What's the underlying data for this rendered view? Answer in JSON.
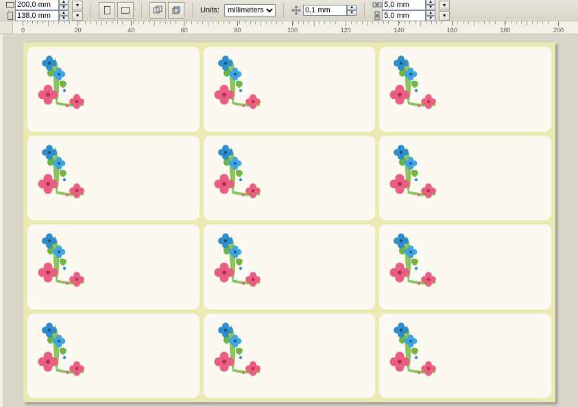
{
  "toolbar": {
    "width": "200,0 mm",
    "height": "138,0 mm",
    "units_label": "Units:",
    "units_value": "millimeters",
    "nudge": "0,1 mm",
    "dup_x": "5,0 mm",
    "dup_y": "5,0 mm"
  },
  "ruler": {
    "ticks": [
      0,
      20,
      40,
      60,
      80,
      100,
      120,
      140,
      160,
      180,
      200
    ]
  },
  "icons": {
    "landscape": "landscape-icon",
    "portrait": "portrait-icon",
    "overlap": "overlap-icon",
    "behind": "behind-icon",
    "nudge": "nudge-arrows-icon",
    "dupx": "duplicate-x-icon",
    "dupy": "duplicate-y-icon",
    "lock": "▾"
  }
}
